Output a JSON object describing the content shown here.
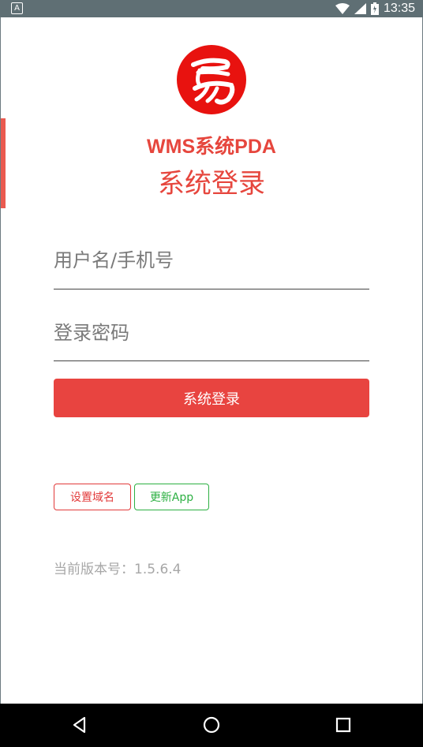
{
  "status_bar": {
    "notification_icon": "A",
    "time": "13:35",
    "icons": [
      "wifi-icon",
      "signal-icon",
      "battery-icon"
    ]
  },
  "brand": {
    "logo_icon": "yi-logo-icon",
    "logo_color": "#e8120f",
    "app_title": "WMS系统PDA",
    "login_title": "系统登录"
  },
  "form": {
    "username_placeholder": "用户名/手机号",
    "password_placeholder": "登录密码",
    "login_label": "系统登录"
  },
  "actions": {
    "set_domain_label": "设置域名",
    "update_app_label": "更新App"
  },
  "version_text": "当前版本号：1.5.6.4",
  "colors": {
    "accent": "#e84440",
    "update_green": "#2db043",
    "status_bar": "#5f6f74"
  },
  "nav_bar": {
    "icons": [
      "back-icon",
      "home-icon",
      "recents-icon"
    ]
  }
}
